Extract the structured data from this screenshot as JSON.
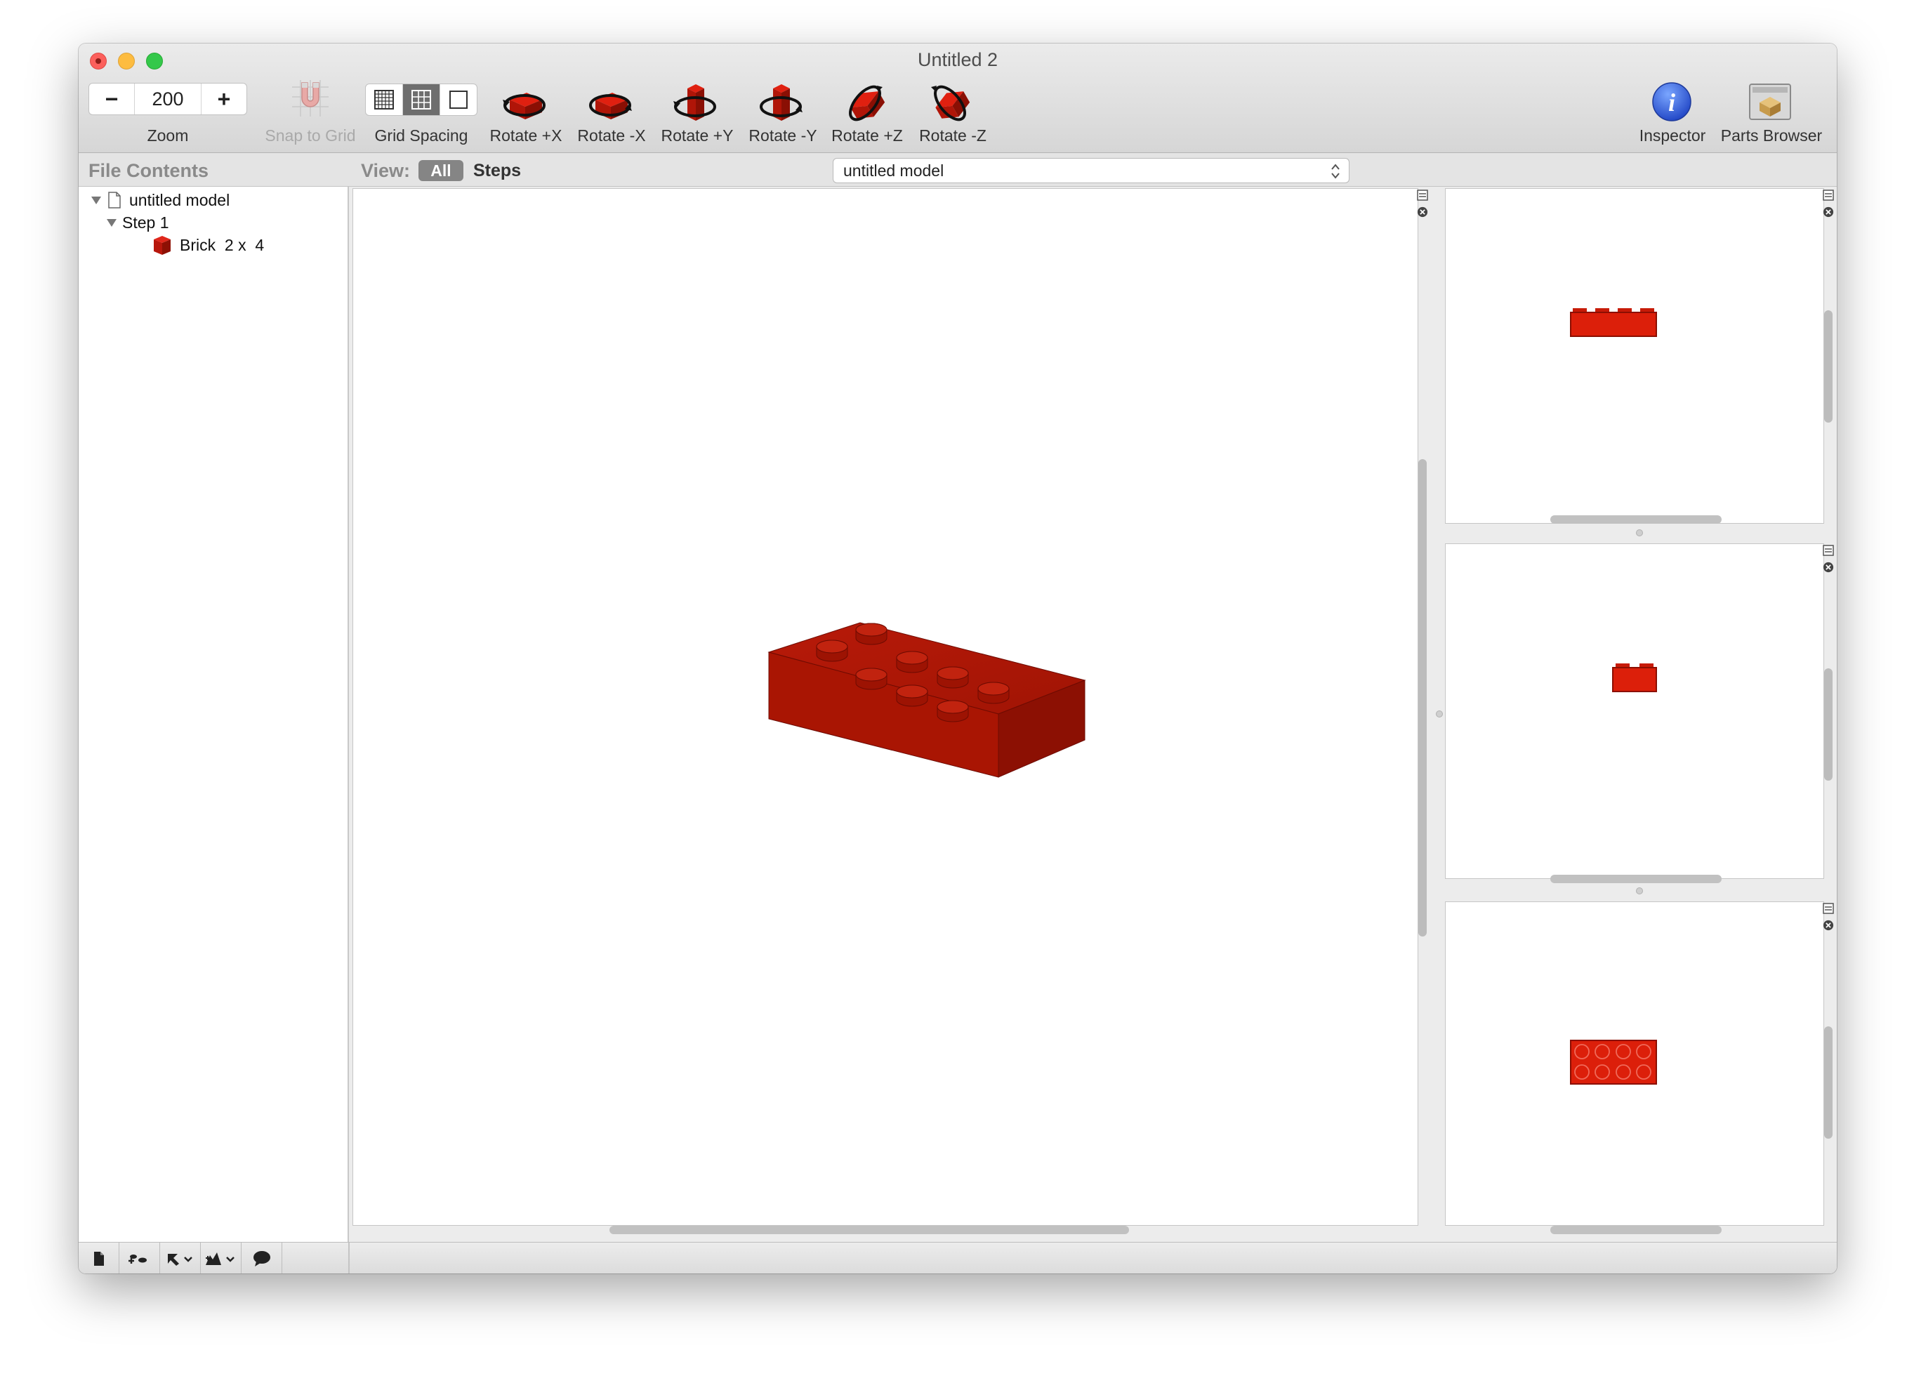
{
  "window": {
    "title": "Untitled 2"
  },
  "toolbar": {
    "zoom": {
      "minus": "−",
      "value": "200",
      "plus": "+",
      "label": "Zoom"
    },
    "snap_to_grid": {
      "label": "Snap to Grid",
      "enabled": false,
      "icon": "magnet-icon"
    },
    "grid_spacing": {
      "label": "Grid Spacing",
      "selected": "medium",
      "options": [
        "fine-grid-icon",
        "medium-grid-icon",
        "coarse-grid-icon"
      ]
    },
    "rotate_buttons": [
      {
        "label": "Rotate +X",
        "icon": "rotate-plus-x-icon"
      },
      {
        "label": "Rotate -X",
        "icon": "rotate-minus-x-icon"
      },
      {
        "label": "Rotate +Y",
        "icon": "rotate-plus-y-icon"
      },
      {
        "label": "Rotate -Y",
        "icon": "rotate-minus-y-icon"
      },
      {
        "label": "Rotate +Z",
        "icon": "rotate-plus-z-icon"
      },
      {
        "label": "Rotate -Z",
        "icon": "rotate-minus-z-icon"
      }
    ],
    "inspector": {
      "label": "Inspector",
      "icon": "info-icon"
    },
    "parts_browser": {
      "label": "Parts Browser",
      "icon": "parts-box-icon"
    }
  },
  "sidebar": {
    "title": "File Contents",
    "tree": {
      "model": "untitled model",
      "step": "Step 1",
      "part": "Brick  2 x  4"
    }
  },
  "view_bar": {
    "label": "View:",
    "all": "All",
    "steps": "Steps",
    "model_select": "untitled model"
  },
  "colors": {
    "brick_red": "#c41a0c",
    "brick_red_dark": "#8e1004",
    "selected_segment": "#858585",
    "accent_blue": "#3a6fe0"
  },
  "bottom_bar": {
    "buttons": [
      "new-document-icon",
      "add-step-icon",
      "add-part-icon",
      "add-model-icon",
      "add-comment-icon"
    ]
  }
}
